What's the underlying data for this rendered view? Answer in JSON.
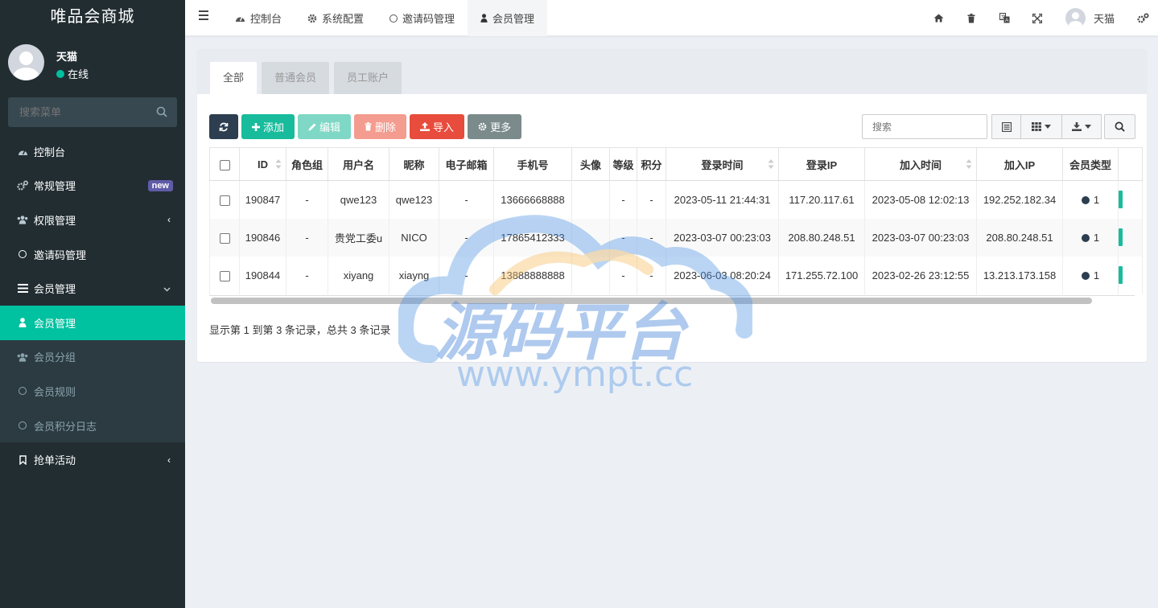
{
  "brand": "唯品会商城",
  "user": {
    "name": "天猫",
    "status": "在线"
  },
  "sidebar": {
    "search_placeholder": "搜索菜单",
    "items": [
      {
        "label": "控制台",
        "icon": "dashboard-icon"
      },
      {
        "label": "常规管理",
        "icon": "cogs-icon",
        "badge": "new"
      },
      {
        "label": "权限管理",
        "icon": "group-icon"
      },
      {
        "label": "邀请码管理",
        "icon": "circle-icon"
      },
      {
        "label": "会员管理",
        "icon": "list-icon"
      },
      {
        "label": "会员管理",
        "icon": "user-icon"
      },
      {
        "label": "会员分组",
        "icon": "group-icon"
      },
      {
        "label": "会员规则",
        "icon": "circle-icon"
      },
      {
        "label": "会员积分日志",
        "icon": "circle-icon"
      },
      {
        "label": "抢单活动",
        "icon": "bookmark-icon"
      }
    ]
  },
  "topnav": {
    "tabs": [
      {
        "label": "控制台",
        "icon": "dashboard-icon"
      },
      {
        "label": "系统配置",
        "icon": "gear-icon"
      },
      {
        "label": "邀请码管理",
        "icon": "circle-icon"
      },
      {
        "label": "会员管理",
        "icon": "user-icon"
      }
    ],
    "user_name": "天猫"
  },
  "panel_tabs": [
    "全部",
    "普通会员",
    "员工账户"
  ],
  "toolbar": {
    "add": "添加",
    "edit": "编辑",
    "delete": "删除",
    "import": "导入",
    "more": "更多"
  },
  "table_search_placeholder": "搜索",
  "table": {
    "headers": [
      "ID",
      "角色组",
      "用户名",
      "昵称",
      "电子邮箱",
      "手机号",
      "头像",
      "等级",
      "积分",
      "登录时间",
      "登录IP",
      "加入时间",
      "加入IP",
      "会员类型"
    ],
    "rows": [
      {
        "id": "190847",
        "role": "-",
        "username": "qwe123",
        "nickname": "qwe123",
        "email": "-",
        "mobile": "13666668888",
        "avatar": "",
        "level": "-",
        "score": "-",
        "logintime": "2023-05-11 21:44:31",
        "loginip": "117.20.117.61",
        "jointime": "2023-05-08 12:02:13",
        "joinip": "192.252.182.34",
        "type": "1"
      },
      {
        "id": "190846",
        "role": "-",
        "username": "贵党工委u",
        "nickname": "NICO",
        "email": "-",
        "mobile": "17865412333",
        "avatar": "",
        "level": "-",
        "score": "-",
        "logintime": "2023-03-07 00:23:03",
        "loginip": "208.80.248.51",
        "jointime": "2023-03-07 00:23:03",
        "joinip": "208.80.248.51",
        "type": "1"
      },
      {
        "id": "190844",
        "role": "-",
        "username": "xiyang",
        "nickname": "xiayng",
        "email": "-",
        "mobile": "13888888888",
        "avatar": "",
        "level": "-",
        "score": "-",
        "logintime": "2023-06-03 08:20:24",
        "loginip": "171.255.72.100",
        "jointime": "2023-02-26 23:12:55",
        "joinip": "13.213.173.158",
        "type": "1"
      }
    ]
  },
  "pagination_info": "显示第 1 到第 3 条记录，总共 3 条记录",
  "watermark": {
    "title": "源码平台",
    "url": "www.ympt.cc"
  },
  "colors": {
    "sidebar": "#222d32",
    "accent": "#00c1a0",
    "link": "#2b8bcf",
    "badge": "#605ca8"
  }
}
